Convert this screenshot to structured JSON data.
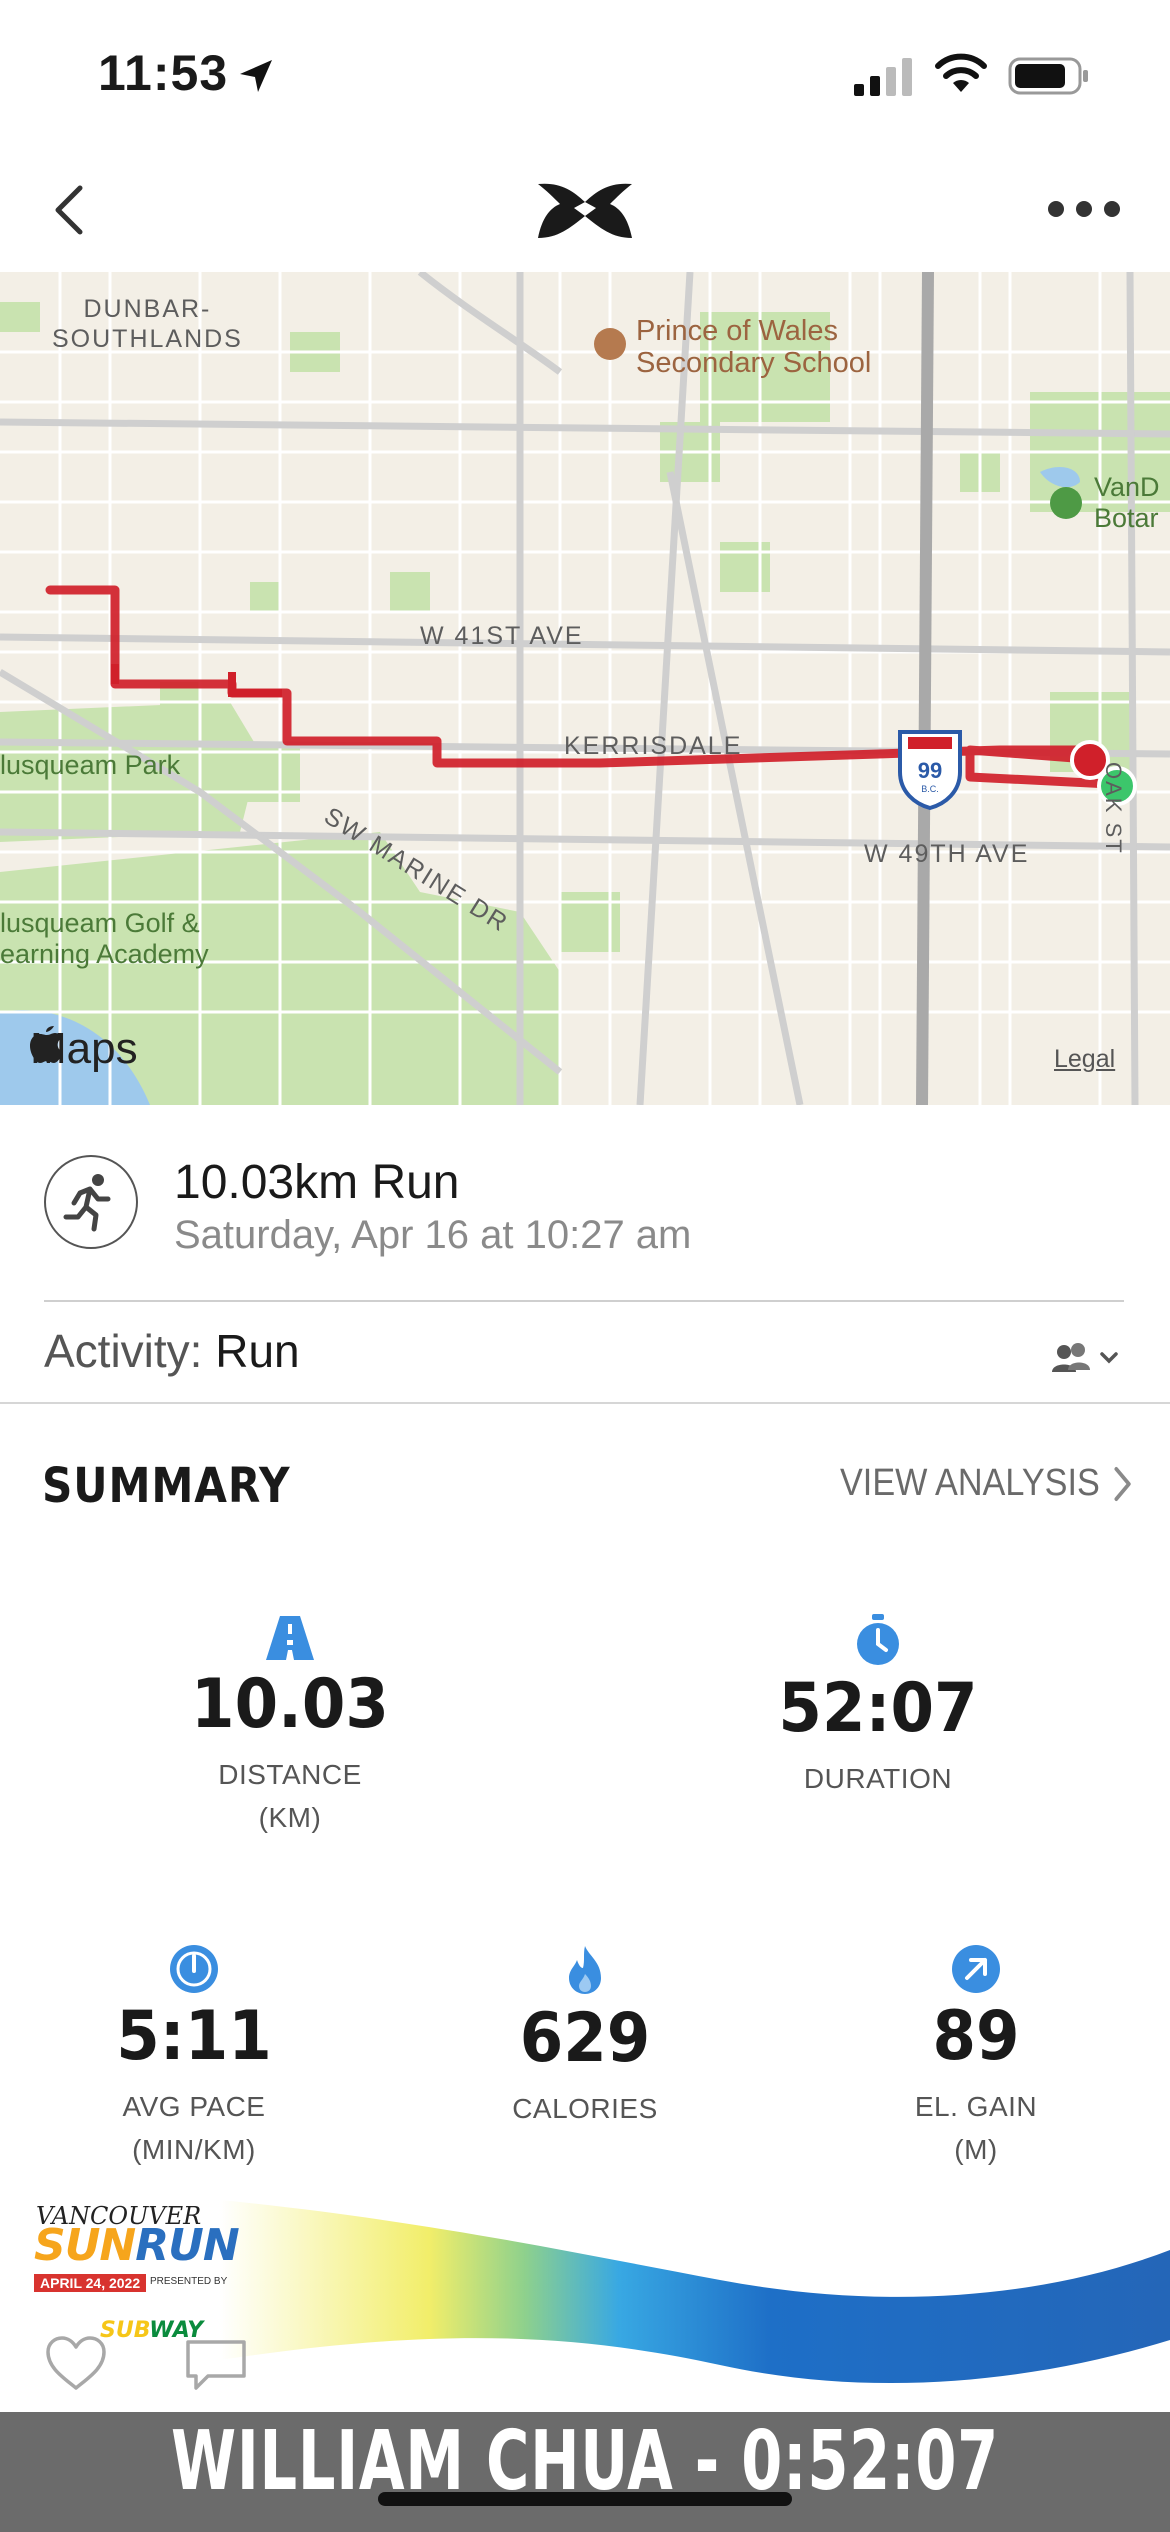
{
  "status_bar": {
    "time": "11:53"
  },
  "nav": {
    "back_label": "Back",
    "more_label": "More options"
  },
  "map": {
    "labels": {
      "dunbar": "DUNBAR-\nSOUTHLANDS",
      "prince": "Prince of Wales\nSecondary School",
      "vand": "VanD\nBotar",
      "w41": "W 41ST AVE",
      "kerrisdale": "KERRISDALE",
      "musqueam_park": "lusqueam Park",
      "sw_marine": "SW MARINE DR",
      "w49": "W 49TH AVE",
      "musqueam_golf": "lusqueam Golf &\nearning Academy",
      "oak_st": "OAK ST",
      "highway": "99",
      "highway_sub": "B.C."
    },
    "brand": "Maps",
    "legal": "Legal",
    "route_color": "#d0202a",
    "start_color": "#2ecc71",
    "end_color": "#d0202a"
  },
  "activity": {
    "title": "10.03km Run",
    "date": "Saturday, Apr 16 at 10:27 am",
    "activity_label": "Activity:",
    "activity_value": "Run"
  },
  "summary": {
    "title": "SUMMARY",
    "view_analysis": "VIEW ANALYSIS",
    "stats": {
      "distance": {
        "value": "10.03",
        "label1": "DISTANCE",
        "label2": "(KM)",
        "icon": "road-icon"
      },
      "duration": {
        "value": "52:07",
        "label1": "DURATION",
        "icon": "stopwatch-icon"
      },
      "pace": {
        "value": "5:11",
        "label1": "AVG PACE",
        "label2": "(MIN/KM)",
        "icon": "speedometer-icon"
      },
      "calories": {
        "value": "629",
        "label1": "CALORIES",
        "icon": "flame-icon"
      },
      "elevation": {
        "value": "89",
        "label1": "EL. GAIN",
        "label2": "(M)",
        "icon": "arrow-up-right-icon"
      }
    },
    "accent_color": "#3a8ee0"
  },
  "banner": {
    "logo_top": "VANCOUVER",
    "logo_sun": "SUN",
    "logo_run": "RUN",
    "date": "APRIL 24, 2022",
    "presented": "PRESENTED BY",
    "sponsor_a": "SUB",
    "sponsor_b": "WAY"
  },
  "name_strip": {
    "text": "WILLIAM CHUA - 0:52:07"
  }
}
